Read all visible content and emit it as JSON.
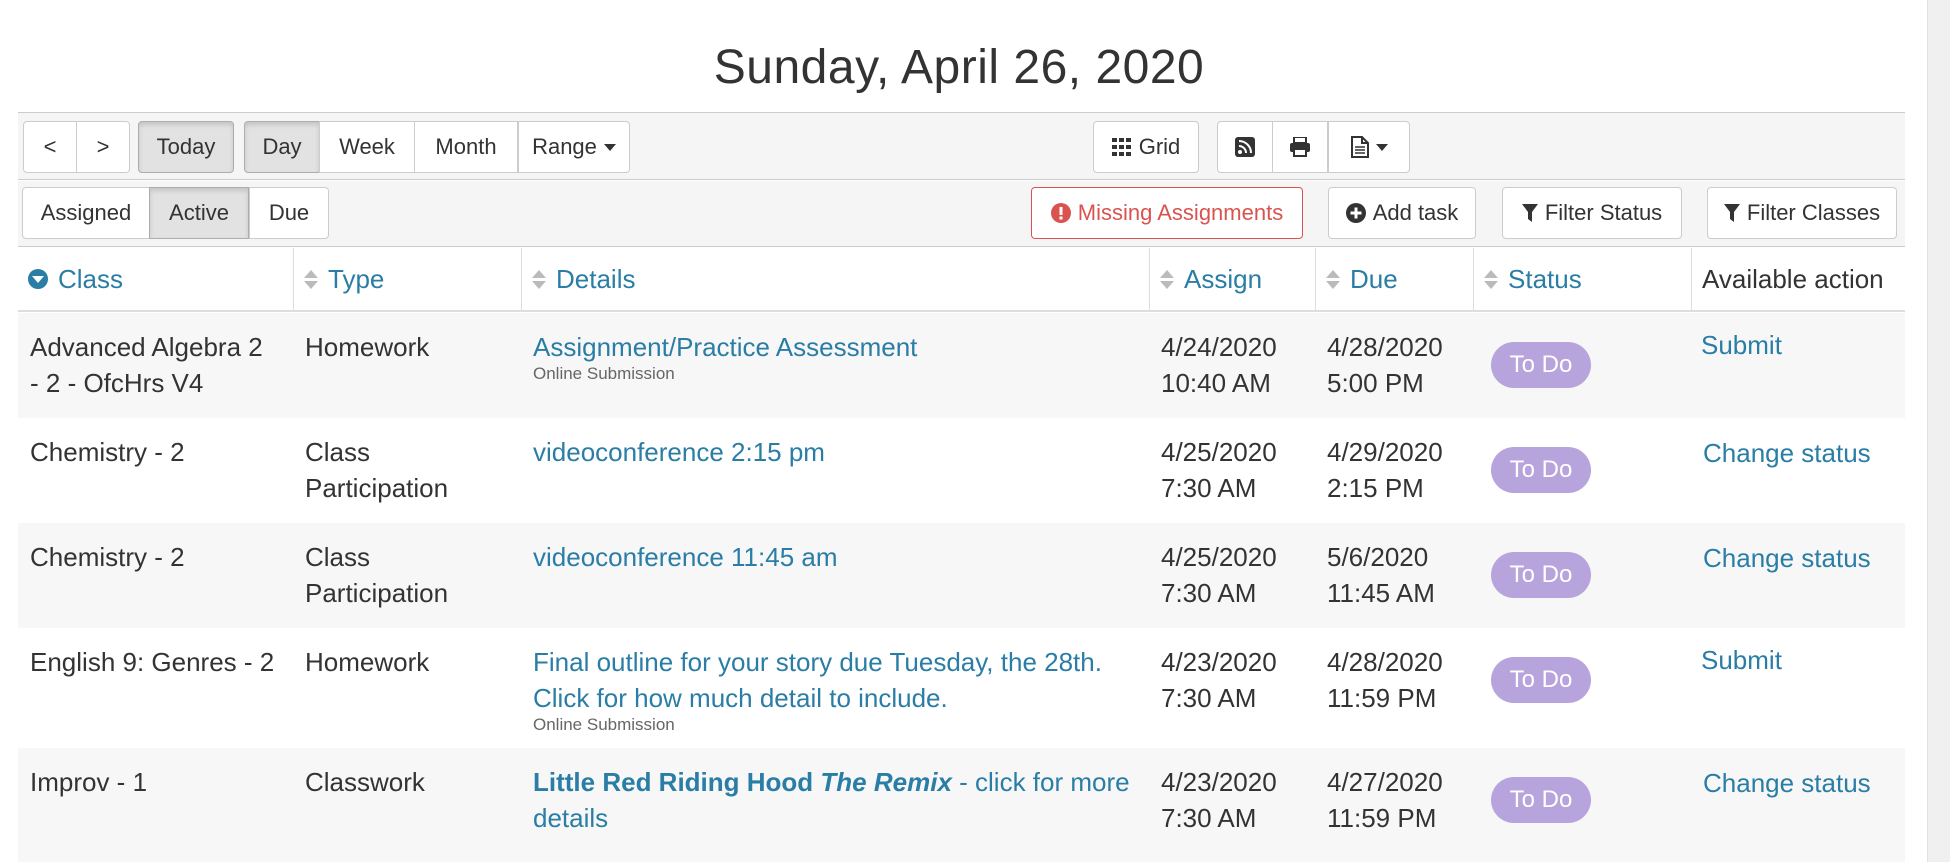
{
  "page": {
    "title": "Sunday, April 26, 2020"
  },
  "toolbar": {
    "prev": "<",
    "next": ">",
    "today": "Today",
    "day": "Day",
    "week": "Week",
    "month": "Month",
    "range": "Range",
    "grid": "Grid"
  },
  "filters": {
    "assigned": "Assigned",
    "active": "Active",
    "due": "Due",
    "missing": "Missing Assignments",
    "add_task": "Add task",
    "filter_status": "Filter Status",
    "filter_classes": "Filter Classes"
  },
  "table": {
    "headers": {
      "class": "Class",
      "type": "Type",
      "details": "Details",
      "assign": "Assign",
      "due": "Due",
      "status": "Status",
      "action": "Available action"
    },
    "rows": [
      {
        "class_l1": "Advanced Algebra 2",
        "class_l2": "- 2 - OfcHrs V4",
        "type_l1": "Homework",
        "type_l2": "",
        "details_l1": "Assignment/Practice Assessment",
        "details_l2": "",
        "sub": "Online Submission",
        "assign_l1": "4/24/2020",
        "assign_l2": "10:40 AM",
        "due_l1": "4/28/2020",
        "due_l2": "5:00 PM",
        "status": "To Do",
        "action": "Submit"
      },
      {
        "class_l1": "Chemistry - 2",
        "class_l2": "",
        "type_l1": "Class",
        "type_l2": "Participation",
        "details_l1": "videoconference 2:15 pm",
        "details_l2": "",
        "sub": "",
        "assign_l1": "4/25/2020",
        "assign_l2": "7:30 AM",
        "due_l1": "4/29/2020",
        "due_l2": "2:15 PM",
        "status": "To Do",
        "action": "Change status"
      },
      {
        "class_l1": "Chemistry - 2",
        "class_l2": "",
        "type_l1": "Class",
        "type_l2": "Participation",
        "details_l1": "videoconference 11:45 am",
        "details_l2": "",
        "sub": "",
        "assign_l1": "4/25/2020",
        "assign_l2": "7:30 AM",
        "due_l1": "5/6/2020",
        "due_l2": "11:45 AM",
        "status": "To Do",
        "action": "Change status"
      },
      {
        "class_l1": "English 9: Genres - 2",
        "class_l2": "",
        "type_l1": "Homework",
        "type_l2": "",
        "details_l1": "Final outline for your story due Tuesday, the 28th.",
        "details_l2": "Click for how much detail to include.",
        "sub": "Online Submission",
        "assign_l1": "4/23/2020",
        "assign_l2": "7:30 AM",
        "due_l1": "4/28/2020",
        "due_l2": "11:59 PM",
        "status": "To Do",
        "action": "Submit"
      },
      {
        "class_l1": "Improv - 1",
        "class_l2": "",
        "type_l1": "Classwork",
        "type_l2": "",
        "details_bold": "Little Red Riding Hood",
        "details_bold_italic": "The Remix",
        "details_rest": " - click for more",
        "details_l2": "details",
        "sub": "",
        "assign_l1": "4/23/2020",
        "assign_l2": "7:30 AM",
        "due_l1": "4/27/2020",
        "due_l2": "11:59 PM",
        "status": "To Do",
        "action": "Change status"
      }
    ]
  },
  "colors": {
    "link": "#2a7da5",
    "badge": "#b8a4dc",
    "danger": "#d9534f"
  }
}
